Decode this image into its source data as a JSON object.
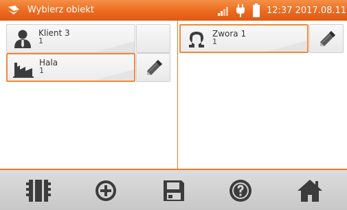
{
  "header": {
    "title": "Wybierz obiekt",
    "time": "12:37 2017.08.11",
    "icons": [
      "app-logo-icon",
      "signal-strength-icon",
      "power-plug-icon",
      "battery-icon"
    ],
    "background_color": "#ec6a1f"
  },
  "left_panel": {
    "items": [
      {
        "name": "Klient 3",
        "count": "1",
        "icon": "person-icon",
        "selected": false
      },
      {
        "name": "Hala",
        "count": "1",
        "icon": "factory-icon",
        "selected": true
      }
    ]
  },
  "right_panel": {
    "items": [
      {
        "name": "Zwora 1",
        "count": "1",
        "icon": "ohm-icon",
        "selected": true
      }
    ]
  },
  "toolbar": {
    "buttons": [
      "memory-icon",
      "add-icon",
      "save-icon",
      "help-icon",
      "home-icon"
    ]
  },
  "colors": {
    "accent": "#f08a3a",
    "icon_dark": "#3c3c3c",
    "toolbar_bg": "#d0d0d0"
  }
}
